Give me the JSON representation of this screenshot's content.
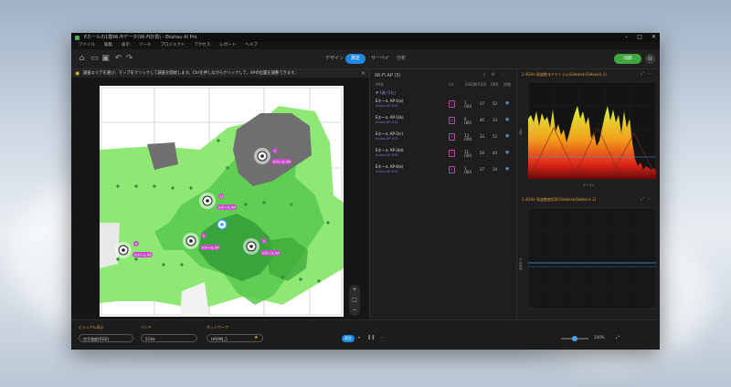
{
  "window": {
    "title": "Eホールの1階Wi-Fiデータ(Wi-Fi計測) - Ekahau AI Pro",
    "controls": [
      "–",
      "□",
      "✕"
    ]
  },
  "menu": [
    "ファイル",
    "編集",
    "表示",
    "ツール",
    "プロジェクト",
    "アクセス",
    "レポート",
    "ヘルプ"
  ],
  "toolbar": {
    "modes": [
      {
        "label": "デザイン",
        "active": false
      },
      {
        "label": "測定",
        "active": true
      },
      {
        "label": "サーベイ",
        "active": false
      },
      {
        "label": "分析",
        "active": false
      }
    ],
    "sync_label": "同期",
    "profile_label": "U"
  },
  "hint": {
    "text": "調査エリアを選び、マップをクリックして調査を開始します。Ctrlを押しながらクリックして、APの位置を調整できます。",
    "close": "×"
  },
  "access_points": [
    {
      "id": "1",
      "label": "Eホール AP"
    },
    {
      "id": "11",
      "label": "Eホール AP"
    },
    {
      "id": "2",
      "label": "Eホール AP"
    },
    {
      "id": "3",
      "label": "Eホール AP"
    },
    {
      "id": "4",
      "label": "Eホール AP"
    }
  ],
  "ap_list": {
    "title": "Wi-Fi AP (5)",
    "header_icons": [
      "⌕",
      "⚙",
      "⋯"
    ],
    "columns": [
      "AP名",
      "Ch",
      "SSID数",
      "RSSI",
      "SNR",
      "詳細"
    ],
    "group": "▼ 1階 (5台)",
    "rows": [
      {
        "name": "Eホール AP-1(a)",
        "sub": "Aruba AP-515",
        "ch": "1",
        "count": "1\n(40)",
        "v1": "57",
        "v2": "52"
      },
      {
        "name": "Eホール AP-1(b)",
        "sub": "Aruba AP-515",
        "ch": "11",
        "count": "6\n(80)",
        "v1": "40",
        "v2": "33"
      },
      {
        "name": "Eホール AP-2(c)",
        "sub": "Aruba AP-515",
        "ch": "6",
        "count": "13\n(40)",
        "v1": "33",
        "v2": "52"
      },
      {
        "name": "Eホール AP-3(d)",
        "sub": "Aruba AP-515",
        "ch": "3",
        "count": "11\n(40)",
        "v1": "56",
        "v2": "44"
      },
      {
        "name": "Eホール AP-4(e)",
        "sub": "Aruba AP-515",
        "ch": "4",
        "count": "1\n(80)",
        "v1": "27",
        "v2": "34"
      }
    ]
  },
  "spectrum_panel": {
    "title": "2.4GHz 周波数スペクトラム(Sidekick/Sidekick 2)",
    "icons": [
      "⤢",
      "⋯"
    ],
    "y_label": "dBm",
    "x_label": "チャネル"
  },
  "channel_panel": {
    "title": "2.4GHz 周波数使用率(Sidekick/Sidekick 2)",
    "icons": [
      "⤢",
      "⋯"
    ],
    "y_label": "使用率 %"
  },
  "bottom": {
    "visualization_label": "ビジュアル表示",
    "visualization_value": "信号強度(RSSI)",
    "band_label": "バンド",
    "band_value": "5GHz",
    "network_label": "ネットワーク",
    "network_value": "HAYAN_5",
    "play_label": "再生",
    "nav": [
      "▸",
      "❚❚",
      "⋯"
    ],
    "zoom_value": "100%",
    "fullscreen": "⤢"
  },
  "colors": {
    "accent_blue": "#1e88e5",
    "accent_green": "#3ea83e",
    "ap_magenta": "#c94fc9",
    "panel_title": "#e39a3b",
    "heat_bright": "#7ee36a",
    "heat_mid": "#4fc24a",
    "heat_dark": "#2e8f35"
  },
  "icons": {
    "home": "home-icon",
    "open": "folder-icon",
    "save": "save-icon",
    "undo": "undo-icon",
    "redo": "redo-icon",
    "bulb": "lightbulb-icon",
    "eye": "eye-icon"
  }
}
